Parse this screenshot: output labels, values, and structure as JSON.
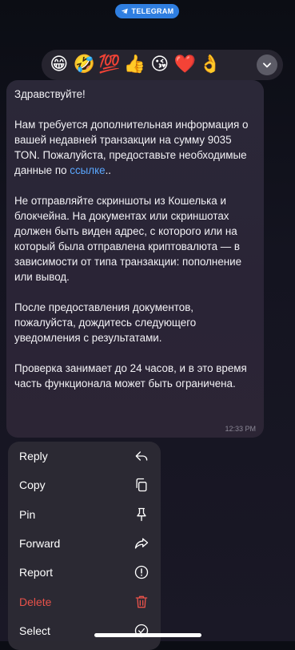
{
  "header": {
    "badge_label": "TELEGRAM"
  },
  "reactions": [
    "😁",
    "🤣",
    "💯",
    "👍",
    "😘",
    "❤️",
    "👌"
  ],
  "message": {
    "greeting": "Здравствуйте!",
    "para1_a": "Нам требуется дополнительная информация о вашей недавней транзакции на сумму  9035 TON. Пожалуйста, предоставьте необходимые данные по ",
    "para1_link": "ссылке",
    "para1_b": "..",
    "para2": "Не отправляйте скриншоты из Кошелька и блокчейна. На документах или скриншотах должен быть виден адрес, с которого или на который была отправлена криптовалюта — в зависимости от типа транзакции: пополнение или вывод.",
    "para3": "После предоставления документов, пожалуйста, дождитесь следующего уведомления с результатами.",
    "para4": "Проверка занимает до 24 часов, и в это время часть функционала может быть ограничена.",
    "time": "12:33 PM"
  },
  "context_menu": {
    "items": [
      {
        "label": "Reply",
        "icon": "reply-icon"
      },
      {
        "label": "Copy",
        "icon": "copy-icon"
      },
      {
        "label": "Pin",
        "icon": "pin-icon"
      },
      {
        "label": "Forward",
        "icon": "forward-icon"
      },
      {
        "label": "Report",
        "icon": "report-icon"
      },
      {
        "label": "Delete",
        "icon": "trash-icon"
      },
      {
        "label": "Select",
        "icon": "select-icon"
      }
    ]
  },
  "colors": {
    "accent": "#2f7ee0",
    "link": "#5aa7ff",
    "danger": "#e8524a"
  }
}
